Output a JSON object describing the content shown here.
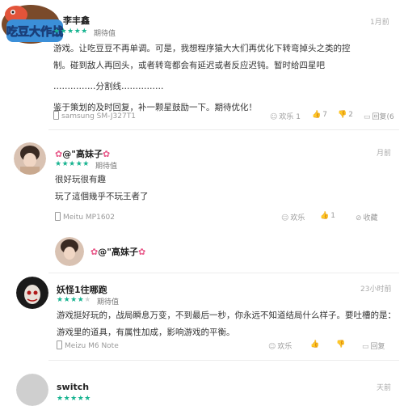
{
  "logo": {
    "text": "吃豆大作战",
    "icon": "game-logo"
  },
  "review1": {
    "name": "李丰鑫",
    "tag": "期待值",
    "time": "1月前",
    "stars": 5,
    "lines": [
      "游戏。让吃豆豆不再单调。可是，我想程序猿大大们再优化下转弯掉头之类的控",
      "制。碰到敌人再回头，或者转弯都会有延迟或者反应迟钝。暂时给四星吧",
      "……………分割线……………",
      "鉴于策划的及时回复，补一颗星鼓励一下。期待优化！"
    ],
    "device": "samsung SM-J327T1",
    "actions": {
      "fun": "欢乐 1",
      "like": "7",
      "dislike": "2",
      "reply": "回复(6"
    }
  },
  "review2": {
    "name": "@\"高妹子",
    "tag": "期待值",
    "time": "月前",
    "stars": 5,
    "lines": [
      "很好玩很有趣",
      "玩了這個幾乎不玩王者了"
    ],
    "device": "Meitu MP1602",
    "actions": {
      "fun": "欢乐",
      "like": "1",
      "collect": "收藏"
    }
  },
  "reply": {
    "name": "@\"高妹子"
  },
  "review3": {
    "name": "妖怪1往哪跑",
    "tag": "期待值",
    "time": "23小时前",
    "stars": 4,
    "lines": [
      "游戏挺好玩的，战局瞬息万变，不到最后一秒，你永远不知道结局什么样子。要吐槽的是：",
      "游戏里的道具，有属性加成，影响游戏的平衡。"
    ],
    "device": "Meizu M6 Note",
    "actions": {
      "fun": "欢乐",
      "like": "",
      "dislike": "",
      "reply": "回复"
    }
  },
  "review4": {
    "name": "switch",
    "time": "天前",
    "stars": 5
  },
  "colors": {
    "star": "#17b390",
    "accent": "#e85a8a"
  }
}
